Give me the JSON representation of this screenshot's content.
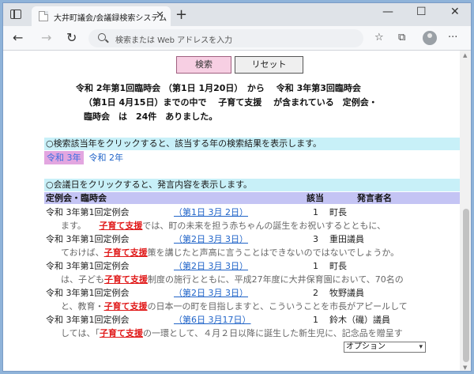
{
  "browser": {
    "tab_title": "大井町議会/会議録検索システム",
    "tab_close": "✕",
    "new_tab": "+",
    "minimize": "—",
    "maximize": "☐",
    "close": "✕",
    "address_placeholder": "検索または Web アドレスを入力",
    "back": "←",
    "forward": "→",
    "refresh": "↻",
    "favorites_icon": "☆",
    "collections_icon": "⧉",
    "menu": "···"
  },
  "page": {
    "search_button": "検索",
    "reset_button": "リセット",
    "summary_line1": "令和 2年第1回臨時会 （第1日 1月20日）　から　 令和 3年第3回臨時会",
    "summary_line2": "（第1日 4月15日）までの中で　 子育て支援　 が含まれている　定例会・",
    "summary_line3": "臨時会　は　24件　ありました。",
    "year_hint": "○検索該当年をクリックすると、該当する年の検索結果を表示します。",
    "years": [
      "令和 3年",
      "令和 2年"
    ],
    "date_hint": "○会議日をクリックすると、発言内容を表示します。",
    "table_headers": {
      "session": "定例会・臨時会",
      "applicable": "該当",
      "speaker": "発言者名"
    },
    "rows": [
      {
        "session": "令和 3年第1回定例会",
        "date": "（第1日 3月 2日）",
        "count": "1",
        "speaker": "町長",
        "snippet_pre": "ます。　　",
        "keyword": "子育て支援",
        "snippet_post": "では、町の未来を担う赤ちゃんの誕生をお祝いするとともに、"
      },
      {
        "session": "令和 3年第1回定例会",
        "date": "（第2日 3月 3日）",
        "count": "3",
        "speaker": "重田議員",
        "snippet_pre": "ておけば、",
        "keyword": "子育て支援",
        "snippet_post": "策を講じたと声高に言うことはできないのではないでしょうか。"
      },
      {
        "session": "令和 3年第1回定例会",
        "date": "（第2日 3月 3日）",
        "count": "1",
        "speaker": "町長",
        "snippet_pre": "は、子ども",
        "keyword": "子育て支援",
        "snippet_post": "制度の施行とともに、平成27年度に大井保育園において、70名の"
      },
      {
        "session": "令和 3年第1回定例会",
        "date": "（第2日 3月 3日）",
        "count": "2",
        "speaker": "牧野議員",
        "snippet_pre": "と、教育・",
        "keyword": "子育て支援",
        "snippet_post": "の日本一の町を目指しますと、こういうことを市長がアピールして"
      },
      {
        "session": "令和 3年第1回定例会",
        "date": "（第6日 3月17日）",
        "count": "1",
        "speaker": "鈴木（磯）議員",
        "snippet_pre": "しては、「",
        "keyword": "子育て支援",
        "snippet_post": "の一環として、４月２日以降に誕生した新生児に、記念品を贈呈す"
      }
    ],
    "option_select": "オプション",
    "chevron": "▾"
  },
  "colors": {
    "search_button_bg": "#f7cfe3",
    "hint_band": "#c8f0f8",
    "header_band": "#c4c4f4",
    "keyword": "#e01818",
    "link": "#1f63c8",
    "selected_year": "#e3a6e0"
  }
}
